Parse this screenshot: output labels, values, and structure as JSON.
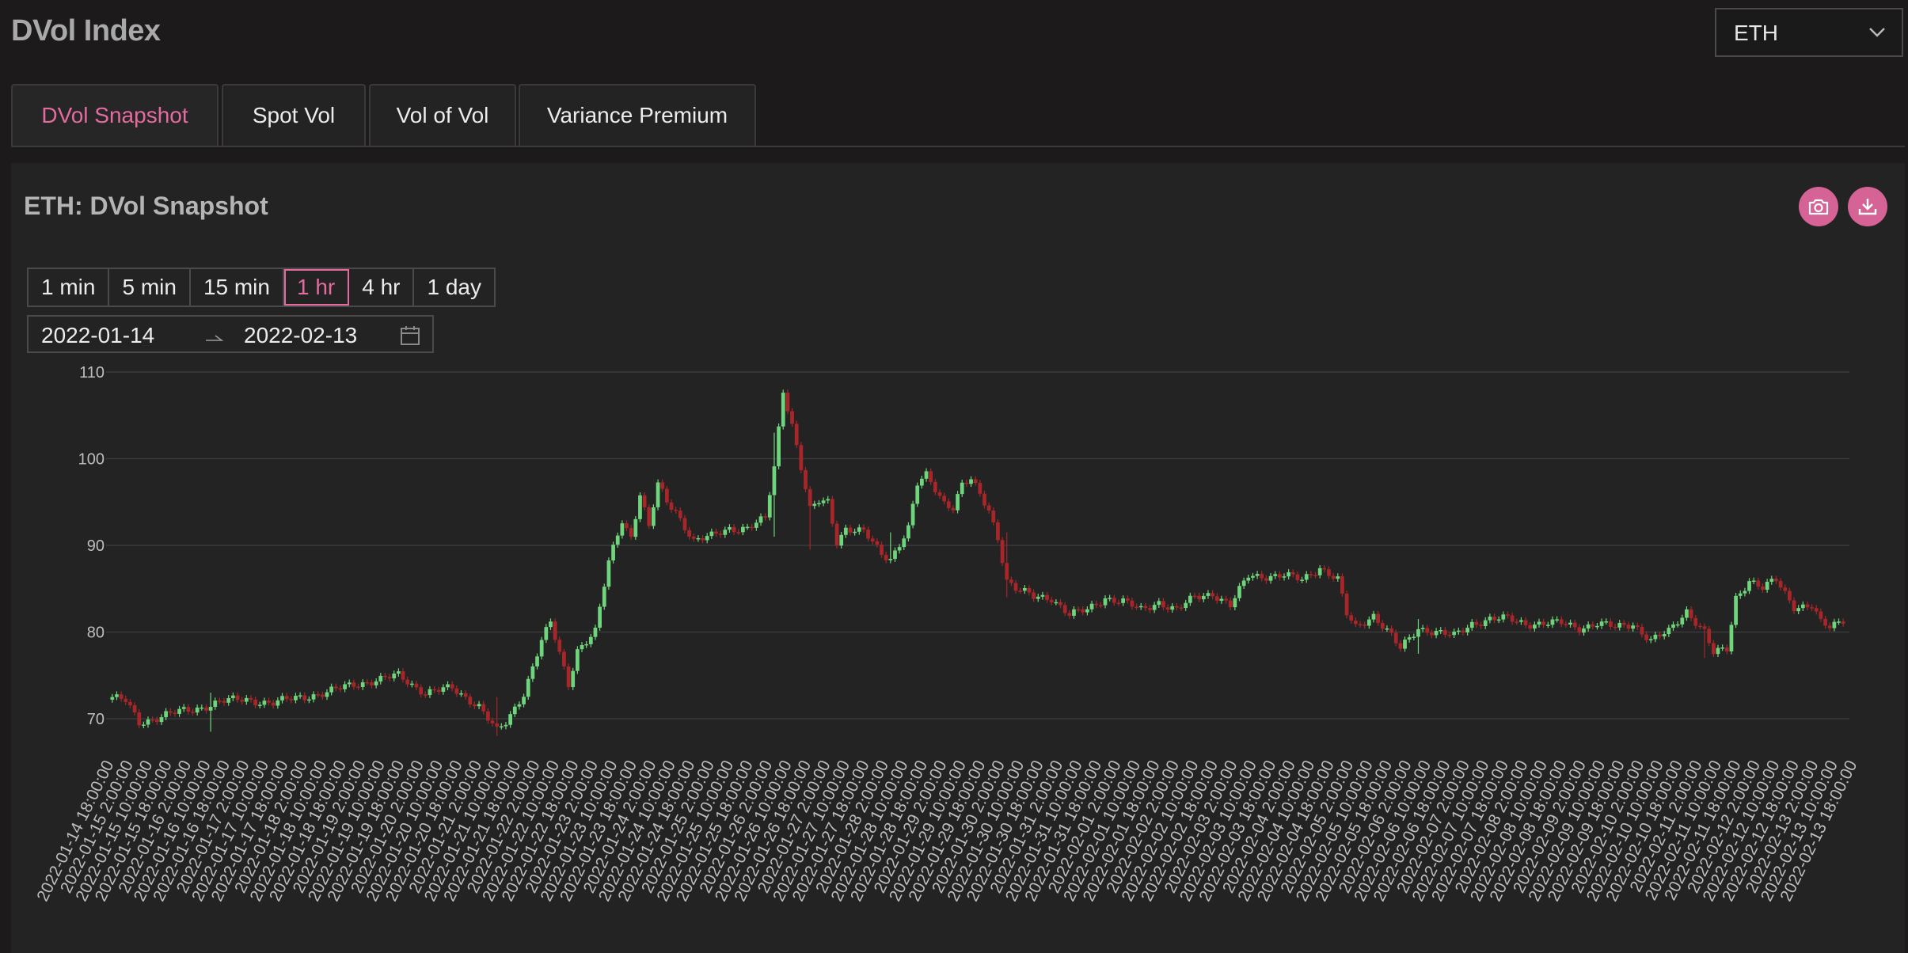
{
  "header": {
    "title": "DVol Index",
    "asset": "ETH"
  },
  "tabs": [
    {
      "label": "DVol Snapshot",
      "active": true
    },
    {
      "label": "Spot Vol",
      "active": false
    },
    {
      "label": "Vol of Vol",
      "active": false
    },
    {
      "label": "Variance Premium",
      "active": false
    }
  ],
  "panel": {
    "title": "ETH: DVol Snapshot",
    "icons": [
      "camera-icon",
      "download-icon"
    ],
    "intervals": [
      "1 min",
      "5 min",
      "15 min",
      "1 hr",
      "4 hr",
      "1 day"
    ],
    "active_interval": "1 hr",
    "date_from": "2022-01-14",
    "date_to": "2022-02-13"
  },
  "colors": {
    "accent": "#d66395",
    "up": "#6fd57c",
    "down": "#a8262a",
    "background": "#232323"
  },
  "chart_data": {
    "type": "candlestick",
    "title": "",
    "ylim": [
      67,
      110
    ],
    "yticks": [
      70,
      80,
      90,
      100,
      110
    ],
    "grid": true,
    "xticks": [
      "2022-01-14 18:00:00",
      "2022-01-15 2:00:00",
      "2022-01-15 10:00:00",
      "2022-01-15 18:00:00",
      "2022-01-16 2:00:00",
      "2022-01-16 10:00:00",
      "2022-01-16 18:00:00",
      "2022-01-17 2:00:00",
      "2022-01-17 10:00:00",
      "2022-01-17 18:00:00",
      "2022-01-18 2:00:00",
      "2022-01-18 10:00:00",
      "2022-01-18 18:00:00",
      "2022-01-19 2:00:00",
      "2022-01-19 10:00:00",
      "2022-01-19 18:00:00",
      "2022-01-20 2:00:00",
      "2022-01-20 10:00:00",
      "2022-01-20 18:00:00",
      "2022-01-21 2:00:00",
      "2022-01-21 10:00:00",
      "2022-01-21 18:00:00",
      "2022-01-22 2:00:00",
      "2022-01-22 10:00:00",
      "2022-01-22 18:00:00",
      "2022-01-23 2:00:00",
      "2022-01-23 10:00:00",
      "2022-01-23 18:00:00",
      "2022-01-24 2:00:00",
      "2022-01-24 10:00:00",
      "2022-01-24 18:00:00",
      "2022-01-25 2:00:00",
      "2022-01-25 10:00:00",
      "2022-01-25 18:00:00",
      "2022-01-26 2:00:00",
      "2022-01-26 10:00:00",
      "2022-01-26 18:00:00",
      "2022-01-27 2:00:00",
      "2022-01-27 10:00:00",
      "2022-01-27 18:00:00",
      "2022-01-28 2:00:00",
      "2022-01-28 10:00:00",
      "2022-01-28 18:00:00",
      "2022-01-29 2:00:00",
      "2022-01-29 10:00:00",
      "2022-01-29 18:00:00",
      "2022-01-30 2:00:00",
      "2022-01-30 10:00:00",
      "2022-01-30 18:00:00",
      "2022-01-31 2:00:00",
      "2022-01-31 10:00:00",
      "2022-01-31 18:00:00",
      "2022-02-01 2:00:00",
      "2022-02-01 10:00:00",
      "2022-02-01 18:00:00",
      "2022-02-02 2:00:00",
      "2022-02-02 10:00:00",
      "2022-02-02 18:00:00",
      "2022-02-03 2:00:00",
      "2022-02-03 10:00:00",
      "2022-02-03 18:00:00",
      "2022-02-04 2:00:00",
      "2022-02-04 10:00:00",
      "2022-02-04 18:00:00",
      "2022-02-05 2:00:00",
      "2022-02-05 10:00:00",
      "2022-02-05 18:00:00",
      "2022-02-06 2:00:00",
      "2022-02-06 10:00:00",
      "2022-02-06 18:00:00",
      "2022-02-07 2:00:00",
      "2022-02-07 10:00:00",
      "2022-02-07 18:00:00",
      "2022-02-08 2:00:00",
      "2022-02-08 10:00:00",
      "2022-02-08 18:00:00",
      "2022-02-09 2:00:00",
      "2022-02-09 10:00:00",
      "2022-02-09 18:00:00",
      "2022-02-10 2:00:00",
      "2022-02-10 10:00:00",
      "2022-02-10 18:00:00",
      "2022-02-11 2:00:00",
      "2022-02-11 10:00:00",
      "2022-02-11 18:00:00",
      "2022-02-12 2:00:00",
      "2022-02-12 10:00:00",
      "2022-02-12 18:00:00",
      "2022-02-13 2:00:00",
      "2022-02-13 10:00:00",
      "2022-02-13 18:00:00"
    ],
    "series_outline": [
      [
        0,
        72.5
      ],
      [
        3,
        72.0
      ],
      [
        6,
        69.5
      ],
      [
        12,
        70.5
      ],
      [
        18,
        71.0
      ],
      [
        24,
        72.0
      ],
      [
        30,
        72.2
      ],
      [
        36,
        71.8
      ],
      [
        42,
        72.5
      ],
      [
        48,
        73.0
      ],
      [
        54,
        74.0
      ],
      [
        60,
        74.5
      ],
      [
        64,
        75.0
      ],
      [
        70,
        73.0
      ],
      [
        76,
        73.5
      ],
      [
        82,
        71.5
      ],
      [
        86,
        68.5
      ],
      [
        88,
        69.5
      ],
      [
        92,
        73.0
      ],
      [
        96,
        79.0
      ],
      [
        98,
        81.0
      ],
      [
        102,
        74.0
      ],
      [
        104,
        78.0
      ],
      [
        108,
        80.0
      ],
      [
        111,
        88.0
      ],
      [
        114,
        93.0
      ],
      [
        116,
        91.0
      ],
      [
        118,
        96.0
      ],
      [
        120,
        92.0
      ],
      [
        122,
        97.0
      ],
      [
        124,
        95.0
      ],
      [
        126,
        94.0
      ],
      [
        130,
        90.5
      ],
      [
        134,
        91.0
      ],
      [
        138,
        92.0
      ],
      [
        142,
        92.0
      ],
      [
        146,
        93.0
      ],
      [
        148,
        99.0
      ],
      [
        150,
        108.0
      ],
      [
        152,
        104.0
      ],
      [
        156,
        94.0
      ],
      [
        158,
        95.0
      ],
      [
        160,
        95.0
      ],
      [
        162,
        90.5
      ],
      [
        164,
        92.0
      ],
      [
        168,
        91.5
      ],
      [
        172,
        89.0
      ],
      [
        174,
        88.5
      ],
      [
        178,
        92.0
      ],
      [
        180,
        97.0
      ],
      [
        182,
        98.0
      ],
      [
        186,
        95.0
      ],
      [
        188,
        94.5
      ],
      [
        190,
        97.0
      ],
      [
        192,
        97.5
      ],
      [
        196,
        94.0
      ],
      [
        198,
        91.0
      ],
      [
        200,
        86.0
      ],
      [
        202,
        85.0
      ],
      [
        206,
        84.0
      ],
      [
        210,
        84.0
      ],
      [
        214,
        82.0
      ],
      [
        218,
        82.5
      ],
      [
        222,
        84.0
      ],
      [
        226,
        83.5
      ],
      [
        230,
        82.5
      ],
      [
        234,
        83.5
      ],
      [
        238,
        82.5
      ],
      [
        242,
        84.0
      ],
      [
        246,
        84.5
      ],
      [
        250,
        83.0
      ],
      [
        254,
        86.5
      ],
      [
        258,
        86.5
      ],
      [
        262,
        86.5
      ],
      [
        266,
        86.0
      ],
      [
        270,
        87.5
      ],
      [
        274,
        86.0
      ],
      [
        276,
        82.0
      ],
      [
        278,
        80.5
      ],
      [
        282,
        82.0
      ],
      [
        286,
        79.5
      ],
      [
        288,
        78.0
      ],
      [
        292,
        80.5
      ],
      [
        296,
        80.0
      ],
      [
        300,
        79.5
      ],
      [
        304,
        81.0
      ],
      [
        308,
        81.5
      ],
      [
        312,
        81.5
      ],
      [
        316,
        81.0
      ],
      [
        320,
        81.0
      ],
      [
        324,
        81.0
      ],
      [
        328,
        80.5
      ],
      [
        332,
        81.0
      ],
      [
        336,
        80.5
      ],
      [
        340,
        81.0
      ],
      [
        344,
        79.0
      ],
      [
        348,
        80.0
      ],
      [
        352,
        82.5
      ],
      [
        356,
        80.0
      ],
      [
        358,
        77.5
      ],
      [
        361,
        78.0
      ],
      [
        363,
        84.0
      ],
      [
        366,
        86.0
      ],
      [
        369,
        85.0
      ],
      [
        372,
        86.0
      ],
      [
        374,
        84.5
      ],
      [
        376,
        83.0
      ],
      [
        380,
        83.0
      ],
      [
        382,
        81.0
      ],
      [
        384,
        80.5
      ],
      [
        387,
        81.5
      ]
    ],
    "spikes": [
      [
        22,
        68.5,
        73.0
      ],
      [
        148,
        91.0,
        103.0
      ],
      [
        156,
        89.5,
        96.0
      ],
      [
        174,
        88.5,
        91.5
      ],
      [
        200,
        84.0,
        91.5
      ],
      [
        86,
        68.0,
        72.5
      ],
      [
        292,
        77.5,
        81.5
      ],
      [
        356,
        77.0,
        80.5
      ]
    ]
  }
}
